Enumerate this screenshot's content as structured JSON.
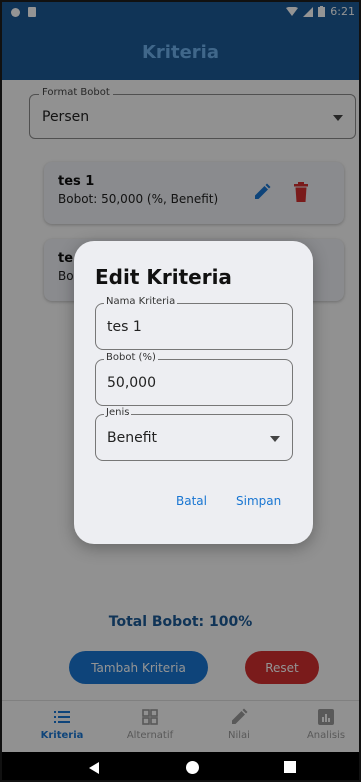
{
  "status_bar": {
    "time": "6:21"
  },
  "app_bar": {
    "title": "Kriteria"
  },
  "format_field": {
    "label": "Format Bobot",
    "value": "Persen"
  },
  "criteria_cards": [
    {
      "title": "tes 1",
      "subtitle": "Bobot: 50,000 (%, Benefit)"
    },
    {
      "title": "te",
      "subtitle": "Bo"
    }
  ],
  "total": {
    "label": "Total Bobot: 100%"
  },
  "actions": {
    "add_label": "Tambah Kriteria",
    "reset_label": "Reset"
  },
  "bottom_nav": [
    {
      "label": "Kriteria",
      "icon": "list-icon",
      "active": true
    },
    {
      "label": "Alternatif",
      "icon": "grid-icon",
      "active": false
    },
    {
      "label": "Nilai",
      "icon": "pencil-icon",
      "active": false
    },
    {
      "label": "Analisis",
      "icon": "chart-icon",
      "active": false
    }
  ],
  "dialog": {
    "title": "Edit Kriteria",
    "name_field": {
      "label": "Nama Kriteria",
      "value": "tes 1"
    },
    "weight_field": {
      "label": "Bobot (%)",
      "value": "50,000"
    },
    "type_field": {
      "label": "Jenis",
      "value": "Benefit"
    },
    "cancel_label": "Batal",
    "save_label": "Simpan"
  },
  "colors": {
    "primary": "#1c5a96",
    "accent": "#1976d2",
    "danger": "#d32f2f",
    "title_text": "#6fb2ee"
  }
}
